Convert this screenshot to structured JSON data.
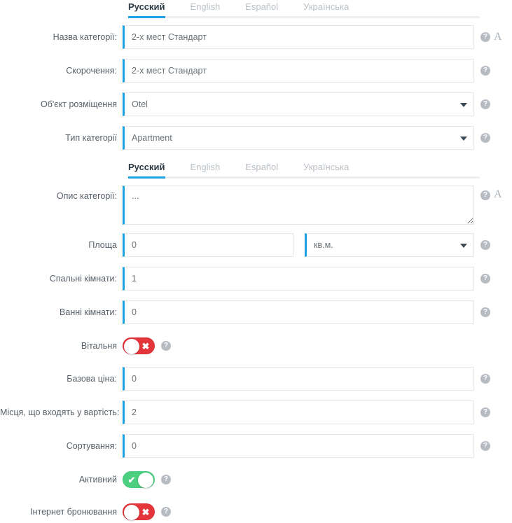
{
  "language_tabs": [
    {
      "label": "Русский",
      "active": true
    },
    {
      "label": "English",
      "active": false
    },
    {
      "label": "Español",
      "active": false
    },
    {
      "label": "Українська",
      "active": false
    }
  ],
  "language_tabs_2": [
    {
      "label": "Русский",
      "active": true
    },
    {
      "label": "English",
      "active": false
    },
    {
      "label": "Español",
      "active": false
    },
    {
      "label": "Українська",
      "active": false
    }
  ],
  "icons": {
    "help": "?",
    "translate": "A",
    "caret": "chevron-down-icon",
    "toggle_on_mark": "✔",
    "toggle_off_mark": "✖"
  },
  "colors": {
    "accent_blue": "#1ca2e3",
    "toggle_on_green": "#4cd080",
    "toggle_off_red": "#e4353a",
    "label_gray": "#57606a",
    "tab_inactive": "#b9c0c6"
  },
  "form": {
    "category_name": {
      "label": "Назва категорії:",
      "value": "2-х мест Стандарт"
    },
    "abbreviation": {
      "label": "Скорочення:",
      "value": "2-х мест Стандарт"
    },
    "accommodation_object": {
      "label": "Об'єкт розміщення",
      "value": "Otel"
    },
    "category_type": {
      "label": "Тип категорії",
      "value": "Apartment"
    },
    "category_description": {
      "label": "Опис категорії:",
      "value": "..."
    },
    "area": {
      "label": "Площа",
      "value": "0",
      "unit": "кв.м."
    },
    "bedrooms": {
      "label": "Спальні кімнати:",
      "value": "1"
    },
    "bathrooms": {
      "label": "Ванні кімнати:",
      "value": "0"
    },
    "living_room": {
      "label": "Вітальня",
      "state": "off"
    },
    "base_price": {
      "label": "Базова ціна:",
      "value": "0"
    },
    "included_places": {
      "label": "Місця, що входять у вартість:",
      "value": "2"
    },
    "sorting": {
      "label": "Сортування:",
      "value": "0"
    },
    "active": {
      "label": "Активний",
      "state": "on"
    },
    "internet_booking": {
      "label": "Інтернет бронювання",
      "state": "off"
    }
  }
}
